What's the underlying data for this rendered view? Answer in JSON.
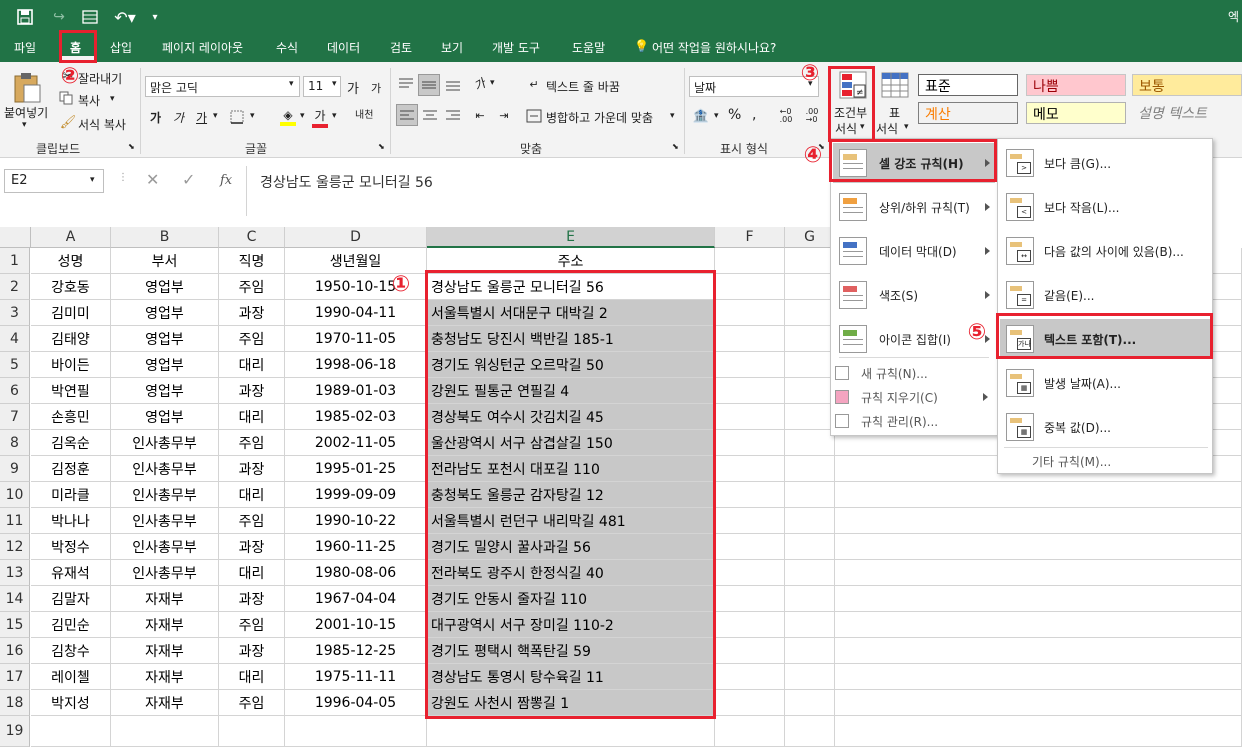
{
  "quickaccess": {
    "right_text": "엑"
  },
  "menu_tabs": [
    "파일",
    "홈",
    "삽입",
    "페이지 레이아웃",
    "수식",
    "데이터",
    "검토",
    "보기",
    "개발 도구",
    "도움말",
    "어떤 작업을 원하시나요?"
  ],
  "clipboard": {
    "paste": "붙여넣기",
    "cut": "잘라내기",
    "copy": "복사",
    "format_painter": "서식 복사",
    "group": "클립보드"
  },
  "font": {
    "name": "맑은 고딕",
    "size": "11",
    "group": "글꼴",
    "bold": "가",
    "italic": "가",
    "underline": "가",
    "grow": "가",
    "shrink": "가",
    "phonetic": "내천"
  },
  "alignment": {
    "wrap": "텍스트 줄 바꿈",
    "merge": "병합하고 가운데 맞춤",
    "group": "맞춤",
    "orient": "가"
  },
  "number": {
    "format": "날짜",
    "percent": "%",
    "group": "표시 형식"
  },
  "cond_format": {
    "label_line1": "조건부",
    "label_line2": "서식"
  },
  "table_format": {
    "label_line1": "표",
    "label_line2": "서식"
  },
  "styles": [
    "표준",
    "나쁨",
    "보통",
    "계산",
    "메모",
    "설명 텍스트"
  ],
  "colors": {
    "accent": "#217346",
    "highlight": "#e8212f",
    "bad_bg": "#ffc7ce",
    "neutral_bg": "#ffeb9c",
    "calc_fg": "#fa7d00",
    "selected_fill": "#c8c8c8"
  },
  "formula_bar": {
    "name_box": "E2",
    "fx": "fx",
    "value": "경상남도 울릉군 모니터길 56"
  },
  "columns": [
    "A",
    "B",
    "C",
    "D",
    "E",
    "F",
    "G"
  ],
  "table": {
    "header": [
      "성명",
      "부서",
      "직명",
      "생년월일",
      "주소"
    ],
    "rows": [
      [
        "강호동",
        "영업부",
        "주임",
        "1950-10-15",
        "경상남도 울릉군 모니터길 56"
      ],
      [
        "김미미",
        "영업부",
        "과장",
        "1990-04-11",
        "서울특별시 서대문구 대박길 2"
      ],
      [
        "김태양",
        "영업부",
        "주임",
        "1970-11-05",
        "충청남도 당진시 백반길 185-1"
      ],
      [
        "바이든",
        "영업부",
        "대리",
        "1998-06-18",
        "경기도 워싱턴군 오르막길 50"
      ],
      [
        "박연필",
        "영업부",
        "과장",
        "1989-01-03",
        "강원도 필통군 연필길 4"
      ],
      [
        "손흥민",
        "영업부",
        "대리",
        "1985-02-03",
        "경상북도 여수시 갓김치길 45"
      ],
      [
        "김옥순",
        "인사총무부",
        "주임",
        "2002-11-05",
        "울산광역시 서구 삼겹살길 150"
      ],
      [
        "김정훈",
        "인사총무부",
        "과장",
        "1995-01-25",
        "전라남도 포천시 대포길 110"
      ],
      [
        "미라클",
        "인사총무부",
        "대리",
        "1999-09-09",
        "충청북도 울릉군 감자탕길 12"
      ],
      [
        "박나나",
        "인사총무부",
        "주임",
        "1990-10-22",
        "서울특별시 런던구 내리막길 481"
      ],
      [
        "박정수",
        "인사총무부",
        "과장",
        "1960-11-25",
        "경기도 밀양시 꿀사과길 56"
      ],
      [
        "유재석",
        "인사총무부",
        "대리",
        "1980-08-06",
        "전라북도 광주시 한정식길 40"
      ],
      [
        "김말자",
        "자재부",
        "과장",
        "1967-04-04",
        "경기도 안동시 줄자길 110"
      ],
      [
        "김민순",
        "자재부",
        "주임",
        "2001-10-15",
        "대구광역시 서구 장미길 110-2"
      ],
      [
        "김창수",
        "자재부",
        "과장",
        "1985-12-25",
        "경기도 평택시 핵폭탄길 59"
      ],
      [
        "레이첼",
        "자재부",
        "대리",
        "1975-11-11",
        "경상남도 통영시 탕수육길 11"
      ],
      [
        "박지성",
        "자재부",
        "주임",
        "1996-04-05",
        "강원도 사천시 짬뽕길 1"
      ]
    ]
  },
  "row_numbers": [
    "1",
    "2",
    "3",
    "4",
    "5",
    "6",
    "7",
    "8",
    "9",
    "10",
    "11",
    "12",
    "13",
    "14",
    "15",
    "16",
    "17",
    "18",
    "19"
  ],
  "cf_menu": [
    {
      "label": "셀 강조 규칙(H)",
      "icon": "highlight-rules-icon"
    },
    {
      "label": "상위/하위 규칙(T)",
      "icon": "top-bottom-icon"
    },
    {
      "label": "데이터 막대(D)",
      "icon": "data-bars-icon"
    },
    {
      "label": "색조(S)",
      "icon": "color-scales-icon"
    },
    {
      "label": "아이콘 집합(I)",
      "icon": "icon-sets-icon"
    }
  ],
  "cf_menu_small": [
    "새 규칙(N)...",
    "규칙 지우기(C)",
    "규칙 관리(R)..."
  ],
  "sub_menu": [
    {
      "label": "보다 큼(G)...",
      "sym": ">"
    },
    {
      "label": "보다 작음(L)...",
      "sym": "<"
    },
    {
      "label": "다음 값의 사이에 있음(B)...",
      "sym": "↔"
    },
    {
      "label": "같음(E)...",
      "sym": "="
    },
    {
      "label": "텍스트 포함(T)...",
      "sym": "가나"
    },
    {
      "label": "발생 날짜(A)...",
      "sym": "▦"
    },
    {
      "label": "중복 값(D)...",
      "sym": "▦"
    }
  ],
  "sub_more": "기타 규칙(M)...",
  "steps": [
    "①",
    "②",
    "③",
    "④",
    "⑤"
  ]
}
